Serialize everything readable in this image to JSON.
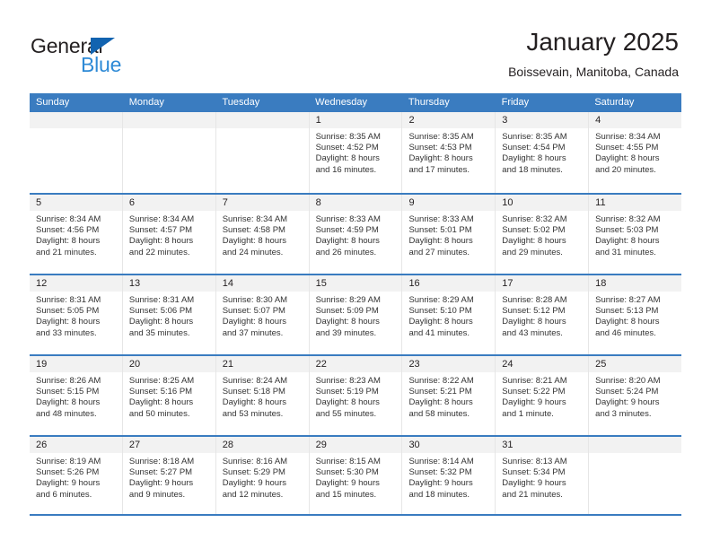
{
  "brand": {
    "word_top": "General",
    "word_bottom": "Blue",
    "triangle_color": "#1263b0",
    "blue_color": "#2e8ad6"
  },
  "header": {
    "title": "January 2025",
    "subtitle": "Boissevain, Manitoba, Canada"
  },
  "theme": {
    "accent": "#3a7cc0",
    "day_band": "#f2f2f2",
    "text": "#231f20"
  },
  "weekdays": [
    "Sunday",
    "Monday",
    "Tuesday",
    "Wednesday",
    "Thursday",
    "Friday",
    "Saturday"
  ],
  "weeks": [
    [
      {
        "day": "",
        "sunrise": "",
        "sunset": "",
        "daylight_line1": "",
        "daylight_line2": ""
      },
      {
        "day": "",
        "sunrise": "",
        "sunset": "",
        "daylight_line1": "",
        "daylight_line2": ""
      },
      {
        "day": "",
        "sunrise": "",
        "sunset": "",
        "daylight_line1": "",
        "daylight_line2": ""
      },
      {
        "day": "1",
        "sunrise": "Sunrise: 8:35 AM",
        "sunset": "Sunset: 4:52 PM",
        "daylight_line1": "Daylight: 8 hours",
        "daylight_line2": "and 16 minutes."
      },
      {
        "day": "2",
        "sunrise": "Sunrise: 8:35 AM",
        "sunset": "Sunset: 4:53 PM",
        "daylight_line1": "Daylight: 8 hours",
        "daylight_line2": "and 17 minutes."
      },
      {
        "day": "3",
        "sunrise": "Sunrise: 8:35 AM",
        "sunset": "Sunset: 4:54 PM",
        "daylight_line1": "Daylight: 8 hours",
        "daylight_line2": "and 18 minutes."
      },
      {
        "day": "4",
        "sunrise": "Sunrise: 8:34 AM",
        "sunset": "Sunset: 4:55 PM",
        "daylight_line1": "Daylight: 8 hours",
        "daylight_line2": "and 20 minutes."
      }
    ],
    [
      {
        "day": "5",
        "sunrise": "Sunrise: 8:34 AM",
        "sunset": "Sunset: 4:56 PM",
        "daylight_line1": "Daylight: 8 hours",
        "daylight_line2": "and 21 minutes."
      },
      {
        "day": "6",
        "sunrise": "Sunrise: 8:34 AM",
        "sunset": "Sunset: 4:57 PM",
        "daylight_line1": "Daylight: 8 hours",
        "daylight_line2": "and 22 minutes."
      },
      {
        "day": "7",
        "sunrise": "Sunrise: 8:34 AM",
        "sunset": "Sunset: 4:58 PM",
        "daylight_line1": "Daylight: 8 hours",
        "daylight_line2": "and 24 minutes."
      },
      {
        "day": "8",
        "sunrise": "Sunrise: 8:33 AM",
        "sunset": "Sunset: 4:59 PM",
        "daylight_line1": "Daylight: 8 hours",
        "daylight_line2": "and 26 minutes."
      },
      {
        "day": "9",
        "sunrise": "Sunrise: 8:33 AM",
        "sunset": "Sunset: 5:01 PM",
        "daylight_line1": "Daylight: 8 hours",
        "daylight_line2": "and 27 minutes."
      },
      {
        "day": "10",
        "sunrise": "Sunrise: 8:32 AM",
        "sunset": "Sunset: 5:02 PM",
        "daylight_line1": "Daylight: 8 hours",
        "daylight_line2": "and 29 minutes."
      },
      {
        "day": "11",
        "sunrise": "Sunrise: 8:32 AM",
        "sunset": "Sunset: 5:03 PM",
        "daylight_line1": "Daylight: 8 hours",
        "daylight_line2": "and 31 minutes."
      }
    ],
    [
      {
        "day": "12",
        "sunrise": "Sunrise: 8:31 AM",
        "sunset": "Sunset: 5:05 PM",
        "daylight_line1": "Daylight: 8 hours",
        "daylight_line2": "and 33 minutes."
      },
      {
        "day": "13",
        "sunrise": "Sunrise: 8:31 AM",
        "sunset": "Sunset: 5:06 PM",
        "daylight_line1": "Daylight: 8 hours",
        "daylight_line2": "and 35 minutes."
      },
      {
        "day": "14",
        "sunrise": "Sunrise: 8:30 AM",
        "sunset": "Sunset: 5:07 PM",
        "daylight_line1": "Daylight: 8 hours",
        "daylight_line2": "and 37 minutes."
      },
      {
        "day": "15",
        "sunrise": "Sunrise: 8:29 AM",
        "sunset": "Sunset: 5:09 PM",
        "daylight_line1": "Daylight: 8 hours",
        "daylight_line2": "and 39 minutes."
      },
      {
        "day": "16",
        "sunrise": "Sunrise: 8:29 AM",
        "sunset": "Sunset: 5:10 PM",
        "daylight_line1": "Daylight: 8 hours",
        "daylight_line2": "and 41 minutes."
      },
      {
        "day": "17",
        "sunrise": "Sunrise: 8:28 AM",
        "sunset": "Sunset: 5:12 PM",
        "daylight_line1": "Daylight: 8 hours",
        "daylight_line2": "and 43 minutes."
      },
      {
        "day": "18",
        "sunrise": "Sunrise: 8:27 AM",
        "sunset": "Sunset: 5:13 PM",
        "daylight_line1": "Daylight: 8 hours",
        "daylight_line2": "and 46 minutes."
      }
    ],
    [
      {
        "day": "19",
        "sunrise": "Sunrise: 8:26 AM",
        "sunset": "Sunset: 5:15 PM",
        "daylight_line1": "Daylight: 8 hours",
        "daylight_line2": "and 48 minutes."
      },
      {
        "day": "20",
        "sunrise": "Sunrise: 8:25 AM",
        "sunset": "Sunset: 5:16 PM",
        "daylight_line1": "Daylight: 8 hours",
        "daylight_line2": "and 50 minutes."
      },
      {
        "day": "21",
        "sunrise": "Sunrise: 8:24 AM",
        "sunset": "Sunset: 5:18 PM",
        "daylight_line1": "Daylight: 8 hours",
        "daylight_line2": "and 53 minutes."
      },
      {
        "day": "22",
        "sunrise": "Sunrise: 8:23 AM",
        "sunset": "Sunset: 5:19 PM",
        "daylight_line1": "Daylight: 8 hours",
        "daylight_line2": "and 55 minutes."
      },
      {
        "day": "23",
        "sunrise": "Sunrise: 8:22 AM",
        "sunset": "Sunset: 5:21 PM",
        "daylight_line1": "Daylight: 8 hours",
        "daylight_line2": "and 58 minutes."
      },
      {
        "day": "24",
        "sunrise": "Sunrise: 8:21 AM",
        "sunset": "Sunset: 5:22 PM",
        "daylight_line1": "Daylight: 9 hours",
        "daylight_line2": "and 1 minute."
      },
      {
        "day": "25",
        "sunrise": "Sunrise: 8:20 AM",
        "sunset": "Sunset: 5:24 PM",
        "daylight_line1": "Daylight: 9 hours",
        "daylight_line2": "and 3 minutes."
      }
    ],
    [
      {
        "day": "26",
        "sunrise": "Sunrise: 8:19 AM",
        "sunset": "Sunset: 5:26 PM",
        "daylight_line1": "Daylight: 9 hours",
        "daylight_line2": "and 6 minutes."
      },
      {
        "day": "27",
        "sunrise": "Sunrise: 8:18 AM",
        "sunset": "Sunset: 5:27 PM",
        "daylight_line1": "Daylight: 9 hours",
        "daylight_line2": "and 9 minutes."
      },
      {
        "day": "28",
        "sunrise": "Sunrise: 8:16 AM",
        "sunset": "Sunset: 5:29 PM",
        "daylight_line1": "Daylight: 9 hours",
        "daylight_line2": "and 12 minutes."
      },
      {
        "day": "29",
        "sunrise": "Sunrise: 8:15 AM",
        "sunset": "Sunset: 5:30 PM",
        "daylight_line1": "Daylight: 9 hours",
        "daylight_line2": "and 15 minutes."
      },
      {
        "day": "30",
        "sunrise": "Sunrise: 8:14 AM",
        "sunset": "Sunset: 5:32 PM",
        "daylight_line1": "Daylight: 9 hours",
        "daylight_line2": "and 18 minutes."
      },
      {
        "day": "31",
        "sunrise": "Sunrise: 8:13 AM",
        "sunset": "Sunset: 5:34 PM",
        "daylight_line1": "Daylight: 9 hours",
        "daylight_line2": "and 21 minutes."
      },
      {
        "day": "",
        "sunrise": "",
        "sunset": "",
        "daylight_line1": "",
        "daylight_line2": ""
      }
    ]
  ]
}
